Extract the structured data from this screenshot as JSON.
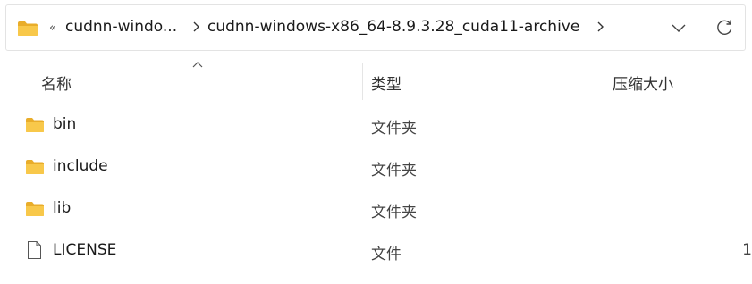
{
  "address_bar": {
    "overflow_glyph": "«",
    "crumbs": [
      "cudnn-windo...",
      "cudnn-windows-x86_64-8.9.3.28_cuda11-archive"
    ]
  },
  "columns": {
    "name": "名称",
    "type": "类型",
    "size": "压缩大小"
  },
  "files": [
    {
      "name": "bin",
      "type": "文件夹",
      "size": "",
      "icon": "folder-icon"
    },
    {
      "name": "include",
      "type": "文件夹",
      "size": "",
      "icon": "folder-icon"
    },
    {
      "name": "lib",
      "type": "文件夹",
      "size": "",
      "icon": "folder-icon"
    },
    {
      "name": "LICENSE",
      "type": "文件",
      "size": "1",
      "icon": "file-icon"
    }
  ],
  "colors": {
    "folder": "#f8c84a",
    "folder_dark": "#e9ad2a"
  }
}
